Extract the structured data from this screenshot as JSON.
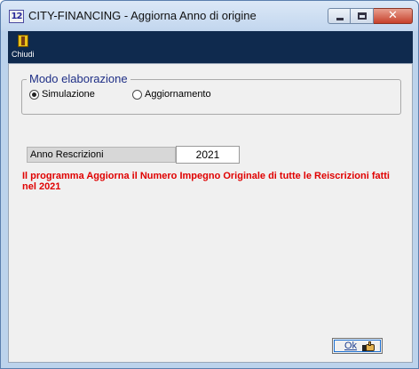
{
  "window": {
    "icon_text": "12",
    "title": "CITY-FINANCING - Aggiorna Anno di origine",
    "close_glyph": "✕"
  },
  "toolbar": {
    "close_label": "Chiudi",
    "close_icon": "door-exit-icon"
  },
  "mode_group": {
    "legend": "Modo elaborazione",
    "options": [
      {
        "label": "Simulazione",
        "selected": true
      },
      {
        "label": "Aggiornamento",
        "selected": false
      }
    ]
  },
  "year_field": {
    "label": "Anno Rescrizioni",
    "value": "2021"
  },
  "message": "Il programma Aggiorna il Numero Impegno Originale di tutte le Reiscrizioni fatti nel 2021",
  "ok_button": {
    "label": "Ok",
    "icon": "thumbs-up-hand-icon"
  },
  "colors": {
    "message": "#e00000",
    "legend": "#1f2f86",
    "toolbar_bg": "#0f2a4e"
  }
}
